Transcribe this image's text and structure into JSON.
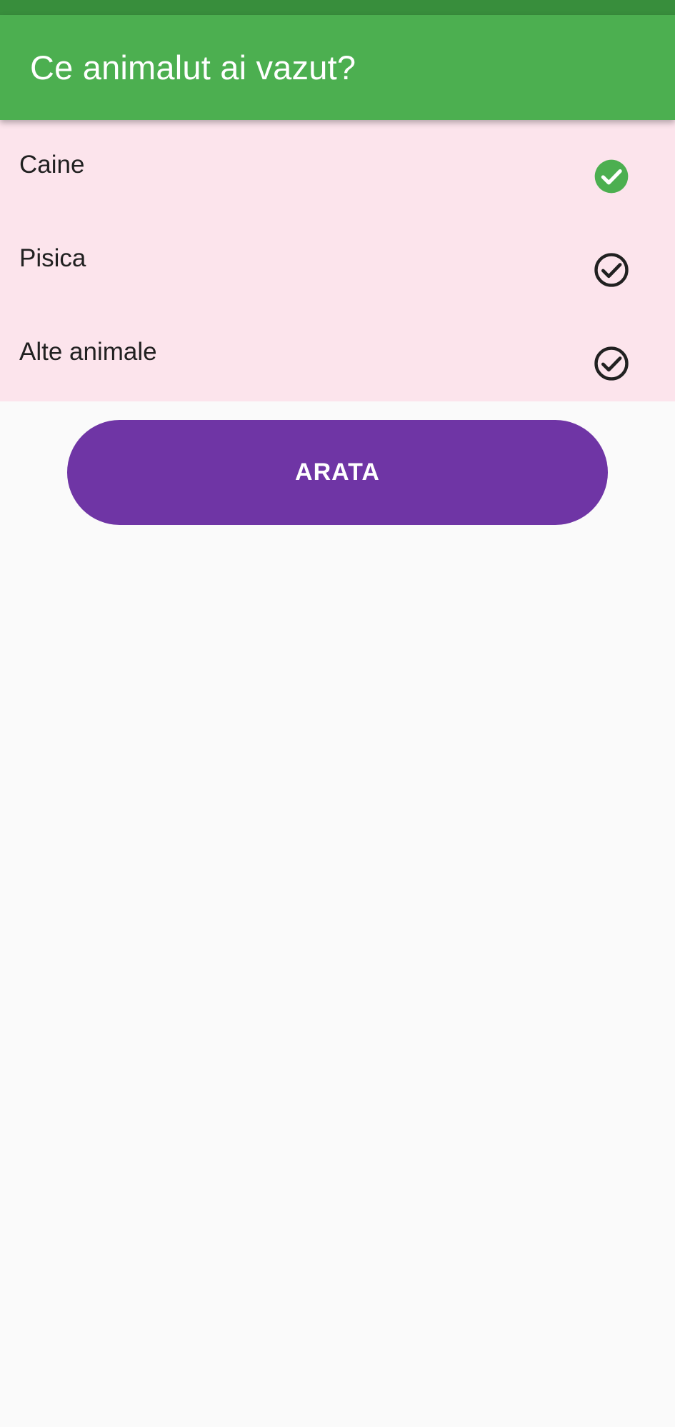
{
  "app_bar": {
    "title": "Ce animalut ai vazut?",
    "background": "#4caf50",
    "status_bar_color": "#388e3c"
  },
  "list": {
    "background": "#fce4ec",
    "items": [
      {
        "label": "Caine",
        "icon": "check-circle-filled-icon",
        "selected": true
      },
      {
        "label": "Pisica",
        "icon": "check-circle-outline-icon",
        "selected": false
      },
      {
        "label": "Alte animale",
        "icon": "check-circle-outline-icon",
        "selected": false
      }
    ],
    "selected_color": "#4caf50",
    "unselected_color": "#212121"
  },
  "action": {
    "label": "ARATA",
    "color": "#6f35a5"
  }
}
